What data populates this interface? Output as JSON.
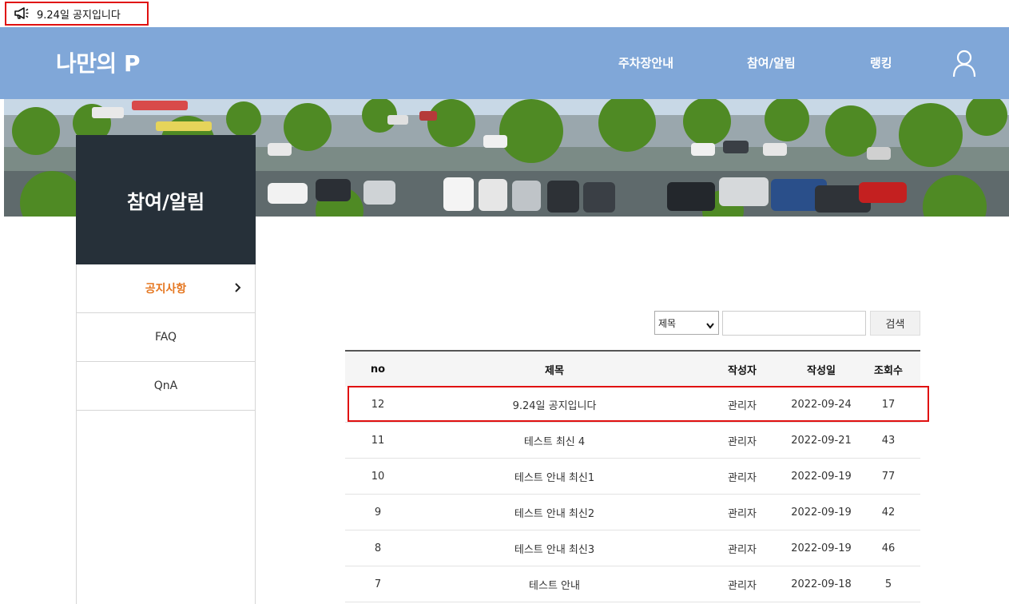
{
  "notice": {
    "text": "9.24일 공지입니다",
    "icon": "megaphone-icon"
  },
  "header": {
    "logo": "나만의 P",
    "nav": [
      "주차장안내",
      "참여/알림",
      "랭킹"
    ],
    "user_icon": "user-icon",
    "bg_color": "#80a7d8"
  },
  "side": {
    "title": "참여/알림",
    "items": [
      {
        "label": "공지사항",
        "active": true
      },
      {
        "label": "FAQ",
        "active": false
      },
      {
        "label": "QnA",
        "active": false
      }
    ],
    "active_color": "#e5761f"
  },
  "search": {
    "select_value": "제목",
    "input_value": "",
    "button_label": "검색"
  },
  "table": {
    "headers": [
      "no",
      "제목",
      "작성자",
      "작성일",
      "조회수"
    ],
    "rows": [
      {
        "no": "12",
        "title": "9.24일 공지입니다",
        "writer": "관리자",
        "date": "2022-09-24",
        "views": "17"
      },
      {
        "no": "11",
        "title": "테스트 최신 4",
        "writer": "관리자",
        "date": "2022-09-21",
        "views": "43"
      },
      {
        "no": "10",
        "title": "테스트 안내 최신1",
        "writer": "관리자",
        "date": "2022-09-19",
        "views": "77"
      },
      {
        "no": "9",
        "title": "테스트 안내 최신2",
        "writer": "관리자",
        "date": "2022-09-19",
        "views": "42"
      },
      {
        "no": "8",
        "title": "테스트 안내 최신3",
        "writer": "관리자",
        "date": "2022-09-19",
        "views": "46"
      },
      {
        "no": "7",
        "title": "테스트 안내",
        "writer": "관리자",
        "date": "2022-09-18",
        "views": "5"
      }
    ]
  }
}
